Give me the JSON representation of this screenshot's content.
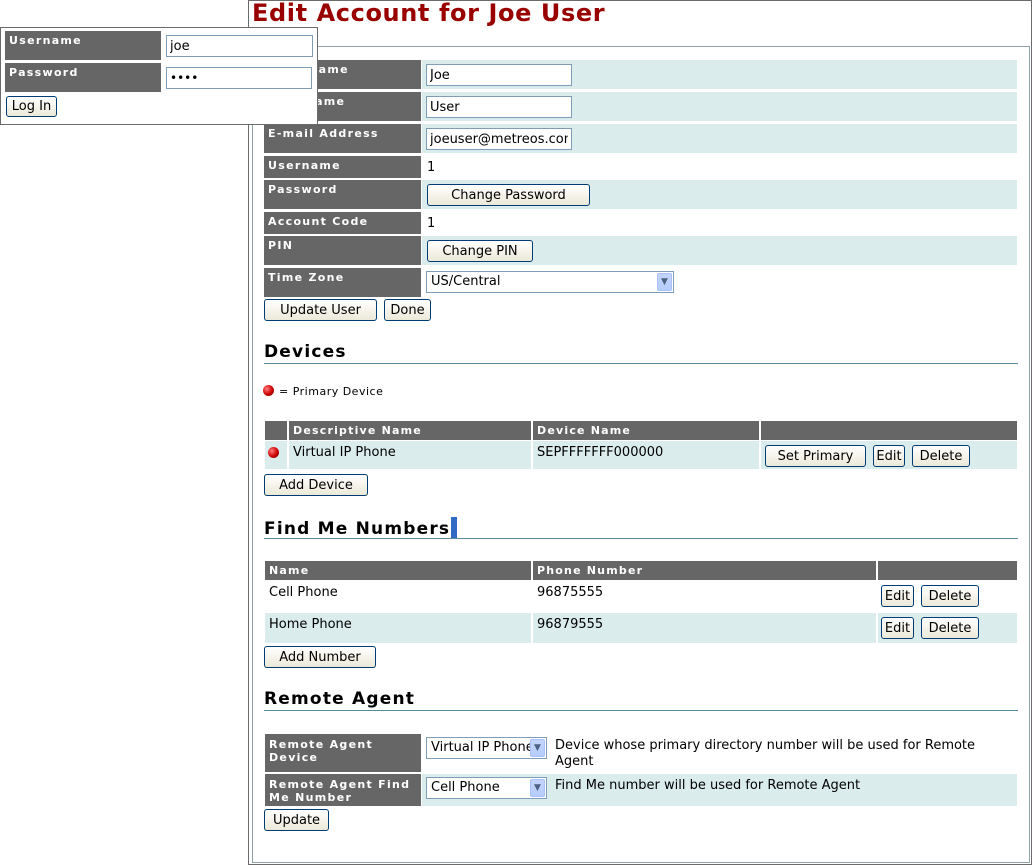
{
  "page_title": "Edit Account for Joe User",
  "account_form": {
    "first_name_label": "First Name",
    "first_name_value": "Joe",
    "last_name_label": "Last Name",
    "last_name_value": "User",
    "email_label": "E-mail Address",
    "email_value": "joeuser@metreos.com",
    "username_label": "Username",
    "username_value": "1",
    "password_label": "Password",
    "change_password_button": "Change Password",
    "account_code_label": "Account Code",
    "account_code_value": "1",
    "pin_label": "PIN",
    "change_pin_button": "Change PIN",
    "time_zone_label": "Time Zone",
    "time_zone_value": "US/Central",
    "update_user_button": "Update User",
    "done_button": "Done"
  },
  "devices": {
    "heading": "Devices",
    "legend_text": "= Primary Device",
    "columns": [
      "Descriptive Name",
      "Device Name"
    ],
    "rows": [
      {
        "descriptive_name": "Virtual IP Phone",
        "device_name": "SEPFFFFFFF000000"
      }
    ],
    "set_primary_button": "Set Primary",
    "edit_button": "Edit",
    "delete_button": "Delete",
    "add_device_button": "Add Device"
  },
  "find_me": {
    "heading": "Find Me Numbers",
    "columns": [
      "Name",
      "Phone Number"
    ],
    "rows": [
      {
        "name": "Cell Phone",
        "phone": "96875555"
      },
      {
        "name": "Home Phone",
        "phone": "96879555"
      }
    ],
    "edit_button": "Edit",
    "delete_button": "Delete",
    "add_number_button": "Add Number"
  },
  "remote_agent": {
    "heading": "Remote Agent",
    "device_label": "Remote Agent Device",
    "device_value": "Virtual IP Phone",
    "device_help": "Device whose primary directory number will be used for Remote Agent",
    "find_me_label": "Remote Agent Find Me Number",
    "find_me_value": "Cell Phone",
    "find_me_help": "Find Me number will be used for Remote Agent",
    "update_button": "Update"
  },
  "login": {
    "username_label": "Username",
    "username_value": "joe",
    "password_label": "Password",
    "password_value": "••••",
    "login_button": "Log In"
  },
  "colors": {
    "title": "#990000",
    "label_bg": "#666666",
    "stripe": "#dbeced",
    "primary_dot": "#cc0000"
  }
}
